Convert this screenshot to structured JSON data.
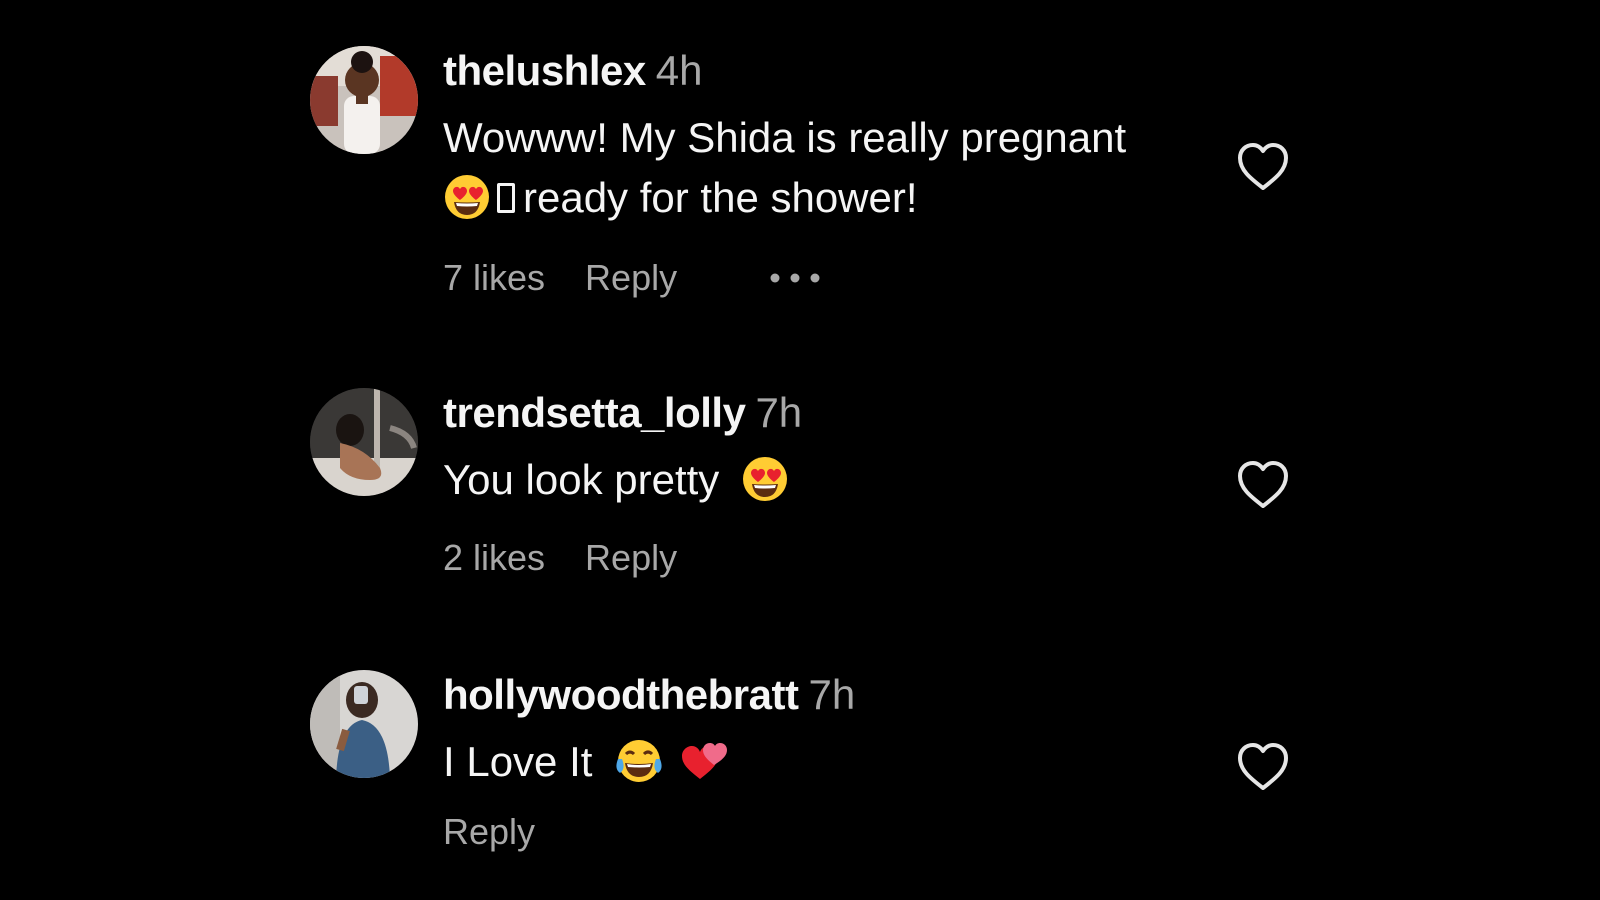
{
  "comments": [
    {
      "username": "thelushlex",
      "time": "4h",
      "text_line1": "Wowww! My Shida is really pregnant",
      "text_line2": "ready for the shower!",
      "emojis": [
        "heart-eyes-emoji",
        "unrendered-glyph"
      ],
      "likes": "7 likes",
      "reply": "Reply",
      "more_icon": "ellipsis-icon",
      "like_icon": "heart-outline-icon"
    },
    {
      "username": "trendsetta_lolly",
      "time": "7h",
      "text": "You look pretty",
      "emojis": [
        "heart-eyes-emoji"
      ],
      "likes": "2 likes",
      "reply": "Reply",
      "like_icon": "heart-outline-icon"
    },
    {
      "username": "hollywoodthebratt",
      "time": "7h",
      "text": "I Love It",
      "emojis": [
        "tears-of-joy-emoji",
        "two-hearts-emoji"
      ],
      "reply": "Reply",
      "like_icon": "heart-outline-icon"
    }
  ],
  "colors": {
    "background": "#000000",
    "primary_text": "#f5f5f5",
    "secondary_text": "#a8a8a8"
  }
}
